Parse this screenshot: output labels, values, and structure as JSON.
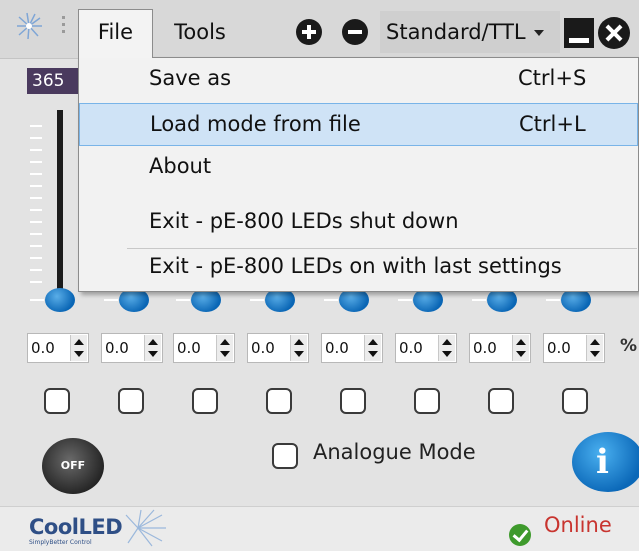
{
  "menubar": {
    "file_label": "File",
    "tools_label": "Tools"
  },
  "mode_select": {
    "value": "Standard/TTL"
  },
  "intensity_readout": "365",
  "file_menu": {
    "items": [
      {
        "label": "Save as",
        "shortcut": "Ctrl+S"
      },
      {
        "label": "Load mode from file",
        "shortcut": "Ctrl+L",
        "highlighted": true
      },
      {
        "label": "About",
        "shortcut": ""
      },
      {
        "label": "Exit - pE-800 LEDs shut down",
        "shortcut": ""
      },
      {
        "label": "Exit - pE-800 LEDs on with last settings",
        "shortcut": ""
      }
    ]
  },
  "channels": [
    {
      "value": "0.0",
      "level": 0
    },
    {
      "value": "0.0",
      "level": 0
    },
    {
      "value": "0.0",
      "level": 0
    },
    {
      "value": "0.0",
      "level": 0
    },
    {
      "value": "0.0",
      "level": 0
    },
    {
      "value": "0.0",
      "level": 0
    },
    {
      "value": "0.0",
      "level": 0
    },
    {
      "value": "0.0",
      "level": 0
    }
  ],
  "unit": "%",
  "off_button": "OFF",
  "analogue_mode_label": "Analogue Mode",
  "info_label": "i",
  "footer": {
    "brand": "CoolLED",
    "tagline": "SimplyBetter Control",
    "status": "Online"
  },
  "colors": {
    "accent": "#0b68b8",
    "status_ok": "#3e9a2c",
    "status_text": "#c8342f",
    "highlight": "#cfe3f6"
  },
  "icons": [
    "app-logo-icon",
    "grip-icon",
    "plus-icon",
    "minus-icon",
    "minimize-icon",
    "close-icon",
    "info-icon",
    "check-icon"
  ]
}
